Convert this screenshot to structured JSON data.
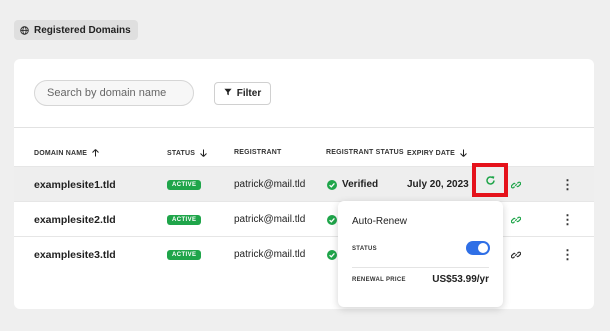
{
  "breadcrumb": {
    "label": "Registered Domains",
    "icon": "globe-icon"
  },
  "search": {
    "placeholder": "Search by domain name",
    "value": ""
  },
  "filter": {
    "label": "Filter",
    "icon": "filter-icon"
  },
  "columns": {
    "domain": "DOMAIN NAME",
    "status": "STATUS",
    "registrant": "REGISTRANT",
    "registrant_status": "REGISTRANT STATUS",
    "expiry": "EXPIRY DATE"
  },
  "rows": [
    {
      "domain": "examplesite1.tld",
      "status": "ACTIVE",
      "registrant": "patrick@mail.tld",
      "registrant_status": "Verified",
      "expiry": "July 20, 2023"
    },
    {
      "domain": "examplesite2.tld",
      "status": "ACTIVE",
      "registrant": "patrick@mail.tld",
      "registrant_status": "",
      "expiry": ""
    },
    {
      "domain": "examplesite3.tld",
      "status": "ACTIVE",
      "registrant": "patrick@mail.tld",
      "registrant_status": "",
      "expiry": ""
    }
  ],
  "popover": {
    "title": "Auto-Renew",
    "status_label": "STATUS",
    "status_on": true,
    "renewal_label": "RENEWAL PRICE",
    "renewal_price": "US$53.99/yr"
  },
  "colors": {
    "active_green": "#1fa54a",
    "toggle_blue": "#2f6fe6",
    "highlight_red": "#e5121b"
  }
}
